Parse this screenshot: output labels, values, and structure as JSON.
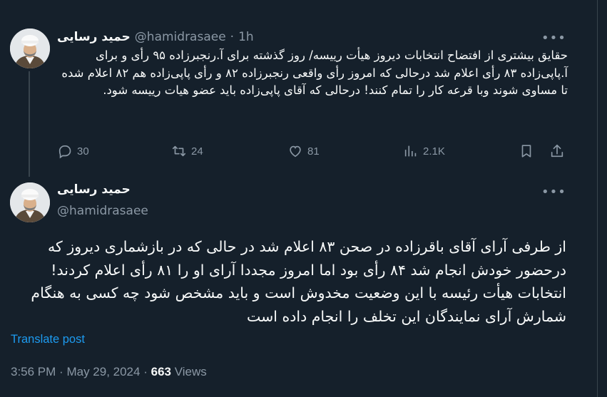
{
  "tweet1": {
    "author_name": "حمید رسایی",
    "handle": "@hamidrasaee",
    "separator": "·",
    "time_ago": "1h",
    "text": "حقایق بیشتری از افتضاح انتخابات دیروز هیأت رییسه/ روز گذشته برای آ.رنجبرزاده ۹۵ رأی و برای آ.پاپی‌زاده ۸۳ رأی اعلام شد درحالی که امروز رأی واقعی رنجبرزاده ۸۲ و رأی پاپی‌زاده هم ۸۲ اعلام شده تا مساوی شوند وبا قرعه کار را تمام کنند! درحالی که آقای پاپی‌زاده باید عضو هیات رییسه شود.",
    "replies": "30",
    "reposts": "24",
    "likes": "81",
    "views": "2.1K",
    "icons": [
      "reply-icon",
      "repost-icon",
      "like-icon",
      "views-icon",
      "bookmark-icon",
      "share-icon",
      "more-icon"
    ]
  },
  "tweet2": {
    "author_name": "حمید رسایی",
    "handle": "@hamidrasaee",
    "text": "از طرفی آرای آقای باقرزاده در صحن ۸۳ اعلام شد در حالی که در بازشماری دیروز که درحضور خودش انجام شد ۸۴ رأی بود اما امروز مجددا آرای او را ۸۱ رأی اعلام کردند! انتخابات هیأت رئیسه با این وضعیت مخدوش است و باید مشخص شود چه کسی به هنگام شمارش آرای نمایندگان این تخلف را انجام داده است",
    "translate_label": "Translate post",
    "time": "3:56 PM",
    "separator": "·",
    "date": "May 29, 2024",
    "views_count": "663",
    "views_label": "Views"
  },
  "colors": {
    "background": "#15202b",
    "text": "#f7f9f9",
    "secondary": "#8b98a5",
    "accent": "#1d9bf0",
    "border": "#38444d"
  }
}
